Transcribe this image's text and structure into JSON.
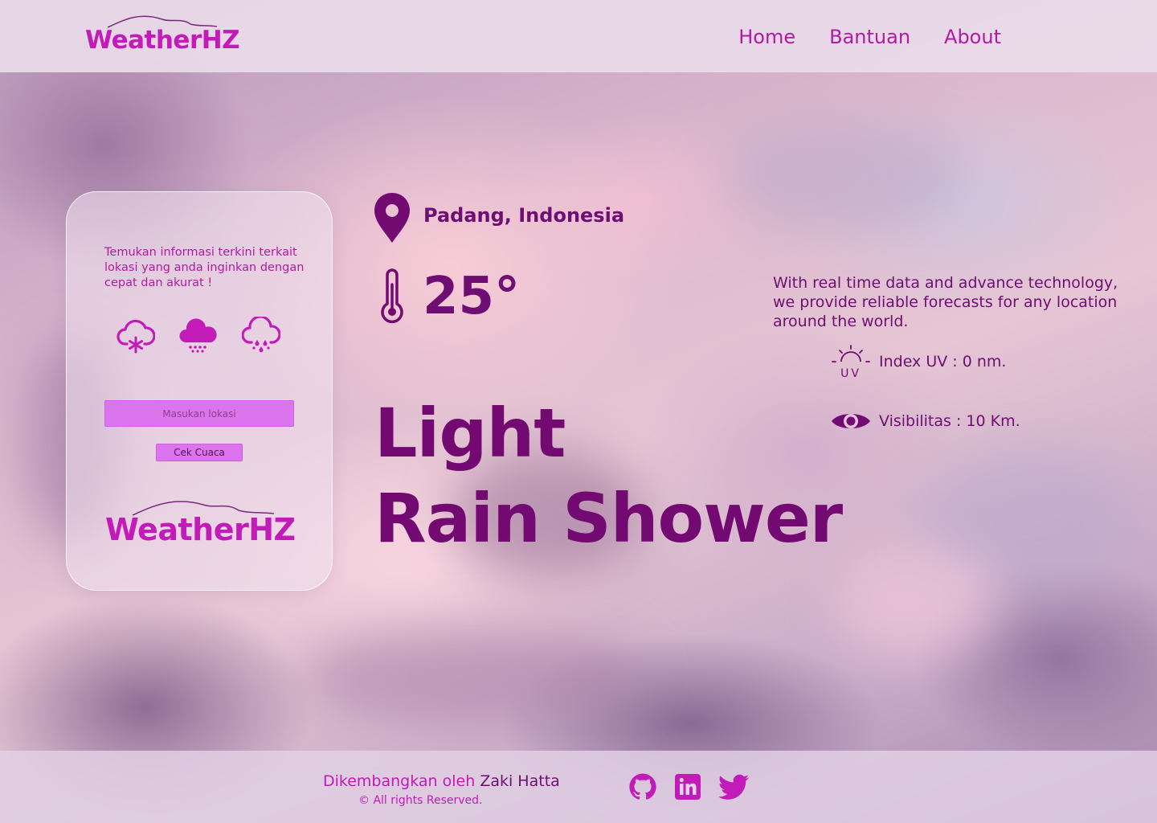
{
  "brand": {
    "name": "WeatherHZ",
    "color": "#c21bb8"
  },
  "nav": {
    "items": [
      "Home",
      "Bantuan",
      "About"
    ]
  },
  "card": {
    "description": "Temukan informasi terkini terkait lokasi yang anda inginkan dengan cepat dan akurat !",
    "icons": [
      "snow-cloud-icon",
      "rain-cloud-icon",
      "sleet-cloud-icon"
    ],
    "input_placeholder": "Masukan lokasi",
    "button_label": "Cek Cuaca"
  },
  "weather": {
    "location": "Padang, Indonesia",
    "temperature": "25°",
    "condition_line1": "Light",
    "condition_line2": "Rain Shower"
  },
  "info": {
    "tagline": "With real time data and advance technology, we provide reliable forecasts for any location around the world.",
    "uv": "Index UV : 0 nm.",
    "uv_icon_label": "UV",
    "visibility": "Visibilitas : 10 Km."
  },
  "footer": {
    "credit_prefix": "Dikembangkan oleh",
    "credit_author": "Zaki Hatta",
    "rights": "© All rights Reserved.",
    "socials": [
      "github-icon",
      "linkedin-icon",
      "twitter-icon"
    ]
  },
  "colors": {
    "accent": "#c21bb8",
    "dark": "#6e0d72",
    "input": "#dc74ee"
  }
}
